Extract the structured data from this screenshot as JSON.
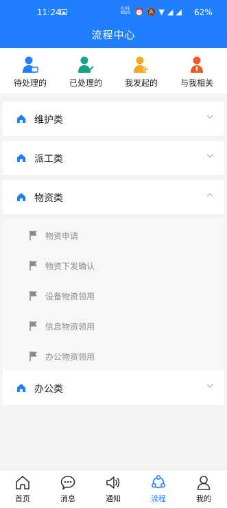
{
  "status_bar": {
    "time": "11:24",
    "net_speed": "0.01",
    "net_unit": "KB/S",
    "battery": "62%"
  },
  "header": {
    "title": "流程中心"
  },
  "quick_actions": [
    {
      "label": "待处理的",
      "color": "#1f7fff"
    },
    {
      "label": "已处理的",
      "color": "#12a386"
    },
    {
      "label": "我发起的",
      "color": "#f5a623"
    },
    {
      "label": "与我相关",
      "color": "#f05a23"
    }
  ],
  "categories": {
    "maintenance": {
      "label": "维护类",
      "expanded": false
    },
    "dispatch": {
      "label": "派工类",
      "expanded": false
    },
    "materials": {
      "label": "物资类",
      "expanded": true,
      "items": [
        "物资申请",
        "物资下发确认",
        "设备物资领用",
        "信息物资领用",
        "办公物资领用"
      ]
    },
    "office": {
      "label": "办公类",
      "expanded": false
    }
  },
  "tabbar": {
    "tabs": [
      {
        "label": "首页",
        "icon": "home-icon"
      },
      {
        "label": "消息",
        "icon": "chat-icon"
      },
      {
        "label": "通知",
        "icon": "speaker-icon"
      },
      {
        "label": "流程",
        "icon": "flow-icon"
      },
      {
        "label": "我的",
        "icon": "user-icon"
      }
    ],
    "active": "流程"
  },
  "colors": {
    "primary": "#1f7fff",
    "background": "#f2f3f5",
    "muted_text": "#8a8a8a"
  }
}
